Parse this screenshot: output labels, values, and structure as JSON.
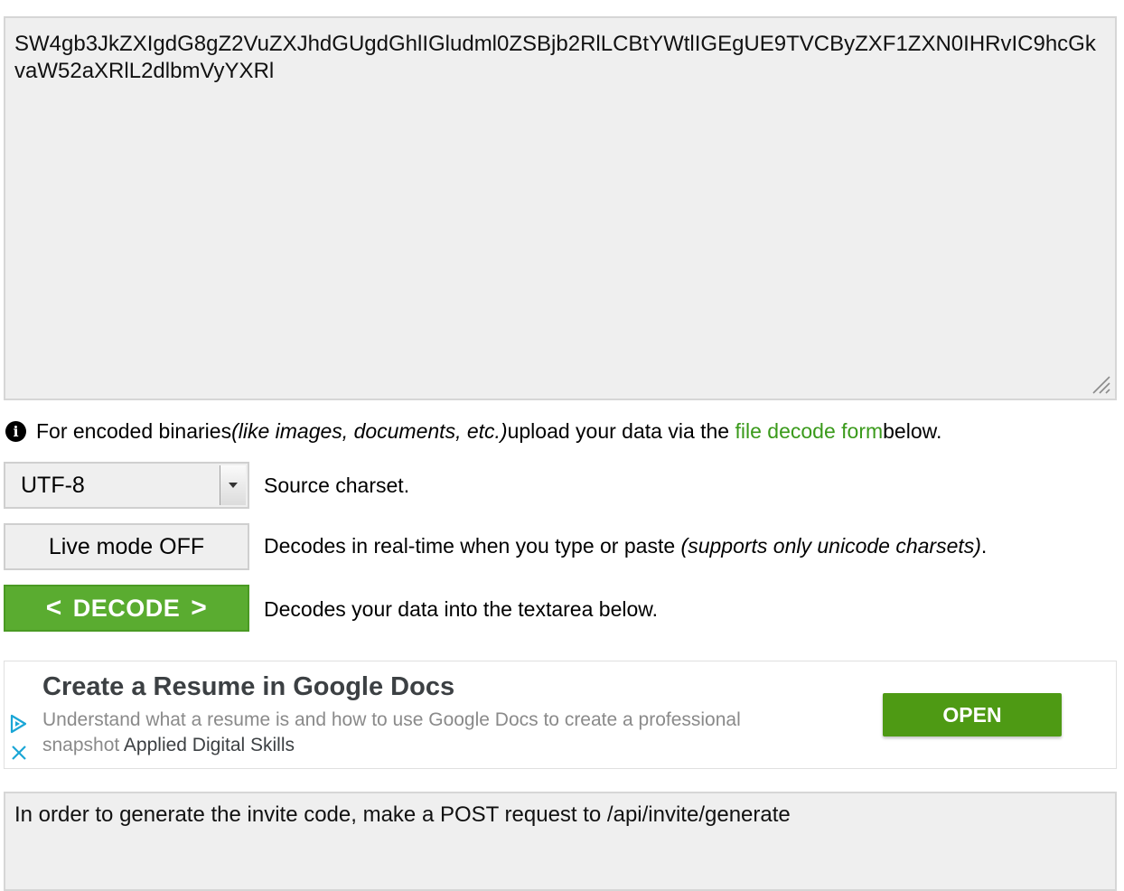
{
  "input": {
    "text": "SW4gb3JkZXIgdG8gZ2VuZXJhdGUgdGhlIGludml0ZSBjb2RlLCBtYWtlIGEgUE9TVCByZXF1ZXN0IHRvIC9hcGkvaW52aXRlL2dlbmVyYXRl"
  },
  "info": {
    "prefix": "For encoded binaries ",
    "italic": "(like images, documents, etc.)",
    "middle": " upload your data via the ",
    "link": "file decode form",
    "suffix": " below."
  },
  "charset": {
    "value": "UTF-8",
    "description": "Source charset."
  },
  "live_mode": {
    "label": "Live mode OFF",
    "desc_prefix": "Decodes in real-time when you type or paste ",
    "desc_italic": "(supports only unicode charsets)",
    "desc_suffix": "."
  },
  "decode": {
    "label": "DECODE",
    "left_chevron": "<",
    "right_chevron": ">",
    "description": "Decodes your data into the textarea below."
  },
  "ad": {
    "title": "Create a Resume in Google Docs",
    "body": "Understand what a resume is and how to use Google Docs to create a professional snapshot",
    "advertiser": "Applied Digital Skills",
    "button": "OPEN"
  },
  "output": {
    "text": "In order to generate the invite code, make a POST request to /api/invite/generate"
  },
  "colors": {
    "accent_green": "#5aac30",
    "link_green": "#3a9a1b",
    "ad_button_green": "#4e9a14",
    "field_gray": "#efefef",
    "adchoices_blue": "#1aa6d6"
  },
  "icons": {
    "info": "info-circle-icon",
    "resize": "resize-grip-icon",
    "dropdown": "chevron-down-icon",
    "adchoices": "adchoices-icon",
    "ad_close": "close-icon"
  }
}
